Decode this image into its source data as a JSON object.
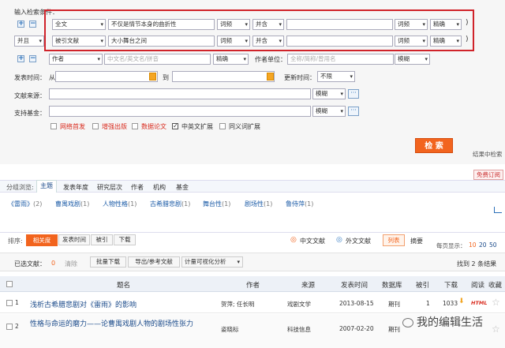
{
  "search": {
    "title": "输入检索条件：",
    "row1": {
      "field": "全文",
      "value": "不仅是情节本身的曲折性",
      "freq": "词频",
      "logic": "并含",
      "value2": "",
      "freq2": "词频",
      "match": "精确"
    },
    "row2": {
      "join": "并且",
      "field": "被引文献",
      "value": "大小舞台之间",
      "freq": "词频",
      "logic": "并含",
      "value2": "",
      "freq2": "词频",
      "match": "精确"
    },
    "author_row": {
      "field": "作者",
      "placeholder": "中文名/英文名/拼音",
      "match": "精确",
      "unit_label": "作者单位：",
      "unit_placeholder": "全称/简称/曾用名",
      "unit_match": "模糊"
    },
    "pub_time": {
      "label": "发表时间：",
      "from": "从",
      "to": "到",
      "update_label": "更新时间：",
      "update_value": "不限"
    },
    "source": {
      "label": "文献来源：",
      "match": "模糊"
    },
    "fund": {
      "label": "支持基金：",
      "match": "模糊"
    },
    "checkboxes": [
      {
        "label": "网络首发",
        "checked": false
      },
      {
        "label": "增强出版",
        "checked": false
      },
      {
        "label": "数据论文",
        "checked": false
      },
      {
        "label": "中英文扩展",
        "checked": true
      },
      {
        "label": "同义词扩展",
        "checked": false
      }
    ],
    "search_button": "检 索",
    "in_results": "结果中检索",
    "subscribe": "免费订阅"
  },
  "browse": {
    "label": "分组浏览:",
    "tabs": [
      "主题",
      "发表年度",
      "研究层次",
      "作者",
      "机构",
      "基金"
    ],
    "topics": [
      {
        "name": "《雷雨》",
        "count": "(2)"
      },
      {
        "name": "曹禺戏剧",
        "count": "(1)"
      },
      {
        "name": "人物性格",
        "count": "(1)"
      },
      {
        "name": "古希腊悲剧",
        "count": "(1)"
      },
      {
        "name": "舞台性",
        "count": "(1)"
      },
      {
        "name": "剧场性",
        "count": "(1)"
      },
      {
        "name": "鲁侍萍",
        "count": "(1)"
      }
    ]
  },
  "sort": {
    "label": "排序:",
    "options": [
      "相关度",
      "发表时间",
      "被引",
      "下载"
    ],
    "chinese": "中文文献",
    "foreign": "外文文献",
    "list": "列表",
    "abstract": "摘要",
    "per_page_label": "每页显示：",
    "per_page": [
      "10",
      "20",
      "50"
    ]
  },
  "toolbar": {
    "selected": "已选文献：",
    "selected_count": "0",
    "clear": "清除",
    "batch": "批量下载",
    "export": "导出/参考文献",
    "viz": "计量可视化分析",
    "found": "找到 2 条结果"
  },
  "table": {
    "headers": [
      "题名",
      "作者",
      "来源",
      "发表时间",
      "数据库",
      "被引",
      "下载",
      "阅读",
      "收藏"
    ],
    "rows": [
      {
        "num": "1",
        "title": "浅析古希腊悲剧对《雷雨》的影响",
        "author": "贺萍; 任长明",
        "source": "戏剧文学",
        "date": "2013-08-15",
        "db": "期刊",
        "cited": "1",
        "downloads": "1033",
        "read": "HTML"
      },
      {
        "num": "2",
        "title": "性格与命运的磨力——论曹禺戏剧人物的剧场性张力",
        "author": "姿晓标",
        "source": "科技信息",
        "date": "2007-02-20",
        "db": "期刊",
        "cited": "",
        "downloads": "",
        "read": ""
      }
    ]
  },
  "watermark": "我的编辑生活"
}
